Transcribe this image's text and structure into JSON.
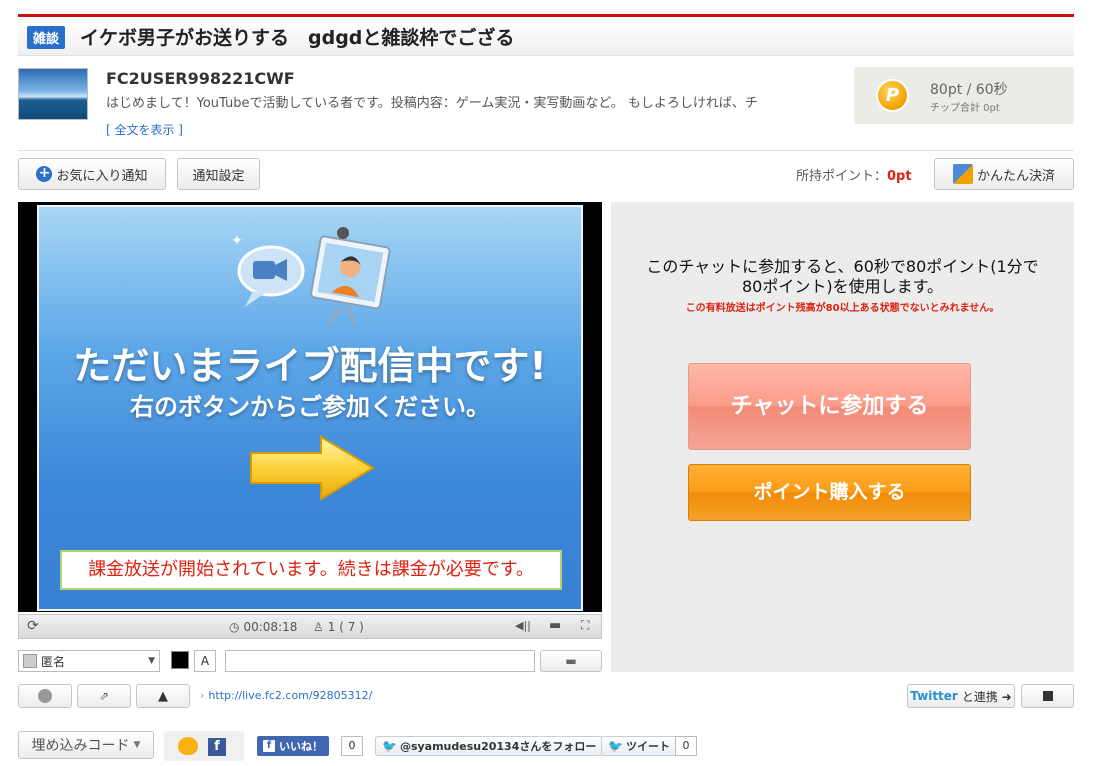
{
  "header": {
    "category": "雑談",
    "title": "イケボ男子がお送りする　gdgdと雑談枠でござる"
  },
  "user": {
    "name": "FC2USER998221CWF",
    "description": "はじめまして！YouTubeで活動している者です。投稿内容：ゲーム実況・実写動画など。 もしよろしければ、チ",
    "show_full": "[ 全文を表示 ]"
  },
  "price": {
    "coin": "P",
    "rate": "80pt / 60秒",
    "tip_total": "チップ合計 0pt"
  },
  "actions": {
    "favorite": "お気に入り通知",
    "notify_settings": "通知設定",
    "points_label": "所持ポイント：",
    "points_value": "0pt",
    "easy_pay": "かんたん決済"
  },
  "video": {
    "headline": "ただいまライブ配信中です!",
    "subline": "右のボタンからご参加ください。",
    "charge_message": "課金放送が開始されています。続きは課金が必要です。"
  },
  "controls": {
    "elapsed": "00:08:18",
    "viewers": "1 ( 7 )"
  },
  "comment": {
    "name": "匿名",
    "font_label": "A",
    "text_color": "#000000"
  },
  "join": {
    "line1": "このチャットに参加すると、60秒で80ポイント(1分で",
    "line2": "80ポイント)を使用します。",
    "warning": "この有料放送はポイント残高が80以上ある状態でないとみれません。",
    "join_button": "チャットに参加する",
    "buy_button": "ポイント購入する"
  },
  "footer": {
    "url": "http://live.fc2.com/92805312/",
    "twitter_word": "Twitter",
    "twitter_rest": "と連携 ➜",
    "embed": "埋め込みコード",
    "like": "いいね！",
    "like_count": "0",
    "follow": "@syamudesu20134さんをフォロー",
    "tweet": "ツイート",
    "tweet_count": "0"
  },
  "colors": {
    "accent_red": "#cc1111",
    "link_blue": "#2a6fc9",
    "join_pink": "#fb9b88",
    "buy_orange": "#fa9b17"
  }
}
